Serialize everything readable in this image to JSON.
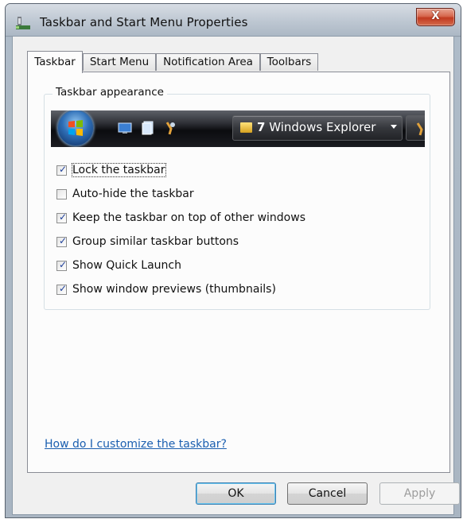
{
  "window": {
    "title": "Taskbar and Start Menu Properties",
    "close_label": "X"
  },
  "tabs": [
    {
      "label": "Taskbar",
      "active": true
    },
    {
      "label": "Start Menu",
      "active": false
    },
    {
      "label": "Notification Area",
      "active": false
    },
    {
      "label": "Toolbars",
      "active": false
    }
  ],
  "group": {
    "title": "Taskbar appearance"
  },
  "preview": {
    "button_count": "7",
    "button_label": "Windows Explorer"
  },
  "options": [
    {
      "label": "Lock the taskbar",
      "checked": true
    },
    {
      "label": "Auto-hide the taskbar",
      "checked": false
    },
    {
      "label": "Keep the taskbar on top of other windows",
      "checked": true
    },
    {
      "label": "Group similar taskbar buttons",
      "checked": true
    },
    {
      "label": "Show Quick Launch",
      "checked": true
    },
    {
      "label": "Show window previews (thumbnails)",
      "checked": true
    }
  ],
  "help_link": "How do I customize the taskbar?",
  "buttons": {
    "ok": "OK",
    "cancel": "Cancel",
    "apply": "Apply"
  },
  "colors": {
    "link": "#1b5fb0",
    "close_button": "#c13a20",
    "default_button_glow": "#6cc6ef"
  },
  "icons": [
    "taskbar-app-icon",
    "start-orb-icon",
    "show-desktop-icon",
    "switch-windows-icon",
    "internet-explorer-icon",
    "folder-icon",
    "checkmark-icon"
  ]
}
